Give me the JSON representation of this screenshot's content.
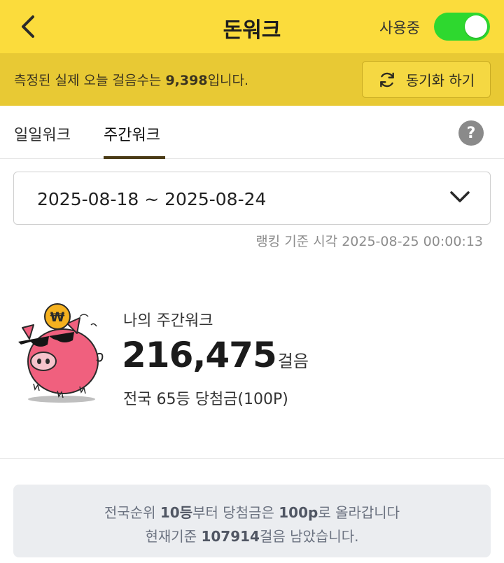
{
  "colors": {
    "header_bg": "#fbdc3c",
    "sync_bar_bg": "#e8c934",
    "toggle_on": "#2ed82f",
    "tab_indicator": "#4a3b16",
    "info_box_bg": "#ebedf0"
  },
  "header": {
    "title": "돈워크",
    "back_icon": "chevron-left-icon",
    "toggle_label": "사용중",
    "toggle_on": true
  },
  "sync_bar": {
    "text_prefix": "측정된 실제 오늘 걸음수는 ",
    "steps_today": "9,398",
    "text_suffix": "입니다.",
    "button_label": "동기화 하기",
    "button_icon": "refresh-icon"
  },
  "tabs": {
    "daily": "일일워크",
    "weekly": "주간워크",
    "active": "weekly",
    "help_icon": "help-icon",
    "help_symbol": "?"
  },
  "week_selector": {
    "value": "2025-08-18 ~ 2025-08-24",
    "icon": "chevron-down-icon"
  },
  "ranking_time": "랭킹 기준 시각 2025-08-25 00:00:13",
  "summary": {
    "label": "나의 주간워크",
    "steps": "216,475",
    "unit": "걸음",
    "rank_text": "전국 65등 당첨금(100P)",
    "mascot": "pig-mascot-icon",
    "coin_symbol": "₩"
  },
  "info": {
    "line1_prefix": "전국순위 ",
    "line1_rank": "10등",
    "line1_mid": "부터 당첨금은 ",
    "line1_amount": "100p",
    "line1_suffix": "로 올라갑니다",
    "line2_prefix": "현재기준 ",
    "line2_steps": "107914",
    "line2_suffix": "걸음 남았습니다."
  }
}
